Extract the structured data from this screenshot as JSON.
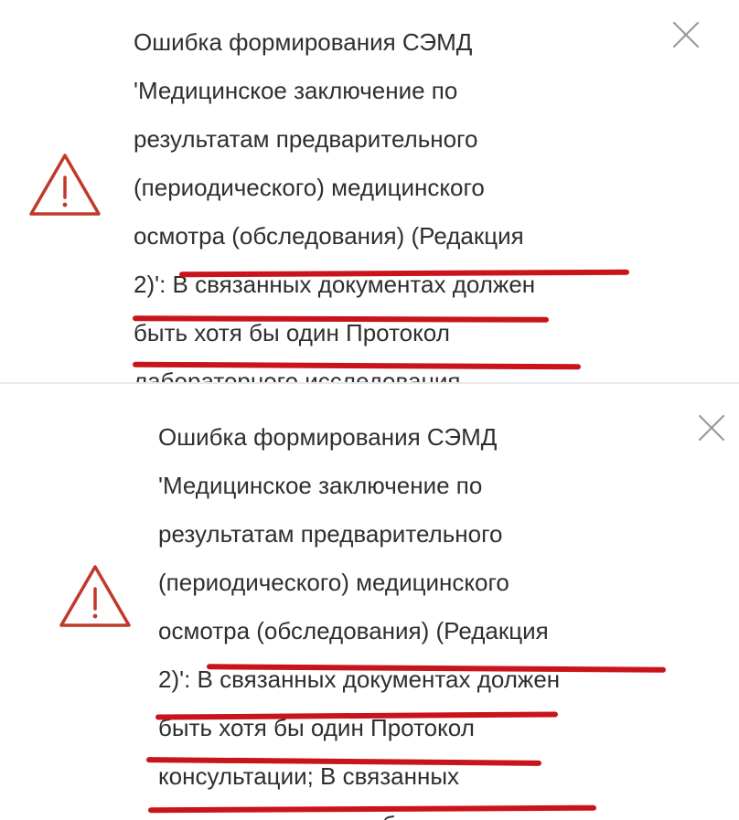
{
  "notifications": [
    {
      "lines": [
        "Ошибка формирования СЭМД",
        "'Медицинское заключение по",
        "результатам предварительного",
        "(периодического) медицинского",
        "осмотра (обследования) (Редакция",
        "2)': В связанных документах должен",
        "быть хотя бы один Протокол",
        "лабораторного исследования"
      ],
      "icon": "warning-triangle-icon",
      "close_icon": "close-icon"
    },
    {
      "lines": [
        "Ошибка формирования СЭМД",
        "'Медицинское заключение по",
        "результатам предварительного",
        "(периодического) медицинского",
        "осмотра (обследования) (Редакция",
        "2)': В связанных документах должен",
        "быть хотя бы один Протокол",
        "консультации; В связанных",
        "документах должен быть хотя ..."
      ],
      "icon": "warning-triangle-icon",
      "close_icon": "close-icon"
    }
  ],
  "colors": {
    "warning": "#c0392b",
    "underline": "#c8141a",
    "text": "#2f2f2f",
    "close": "#9a9a9a"
  }
}
